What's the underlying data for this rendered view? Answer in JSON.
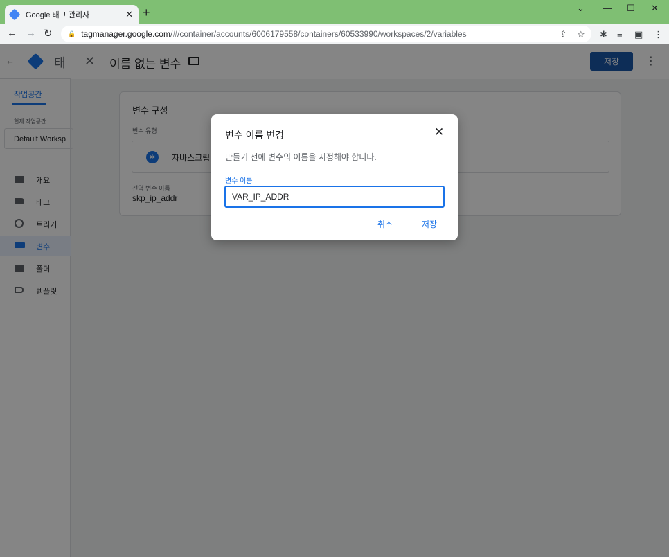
{
  "browser": {
    "tab_title": "Google 태그 관리자",
    "url_host": "tagmanager.google.com",
    "url_path": "/#/container/accounts/6006179558/containers/60533990/workspaces/2/variables"
  },
  "app": {
    "app_name_partial": "태",
    "sidebar": {
      "workspace_tab": "작업공간",
      "current_workspace_label": "현재 작업공간",
      "current_workspace": "Default Worksp",
      "items": [
        {
          "label": "개요",
          "icon": "briefcase-icon"
        },
        {
          "label": "태그",
          "icon": "tag-icon"
        },
        {
          "label": "트리거",
          "icon": "trigger-icon"
        },
        {
          "label": "변수",
          "icon": "variables-icon"
        },
        {
          "label": "폴더",
          "icon": "folder-icon"
        },
        {
          "label": "템플릿",
          "icon": "template-icon"
        }
      ]
    },
    "header": {
      "variable_name": "이름 없는 변수",
      "save_label": "저장"
    },
    "card": {
      "title": "변수 구성",
      "type_label": "변수 유형",
      "type_value": "자바스크립",
      "global_name_label": "전역 변수 이름",
      "global_name_value": "skp_ip_addr"
    }
  },
  "dialog": {
    "title": "변수 이름 변경",
    "description": "만들기 전에 변수의 이름을 지정해야 합니다.",
    "field_label": "변수 이름",
    "field_value": "VAR_IP_ADDR",
    "cancel_label": "취소",
    "save_label": "저장"
  },
  "colors": {
    "accent": "#1a73e8",
    "tabbar": "#7fbf73"
  }
}
